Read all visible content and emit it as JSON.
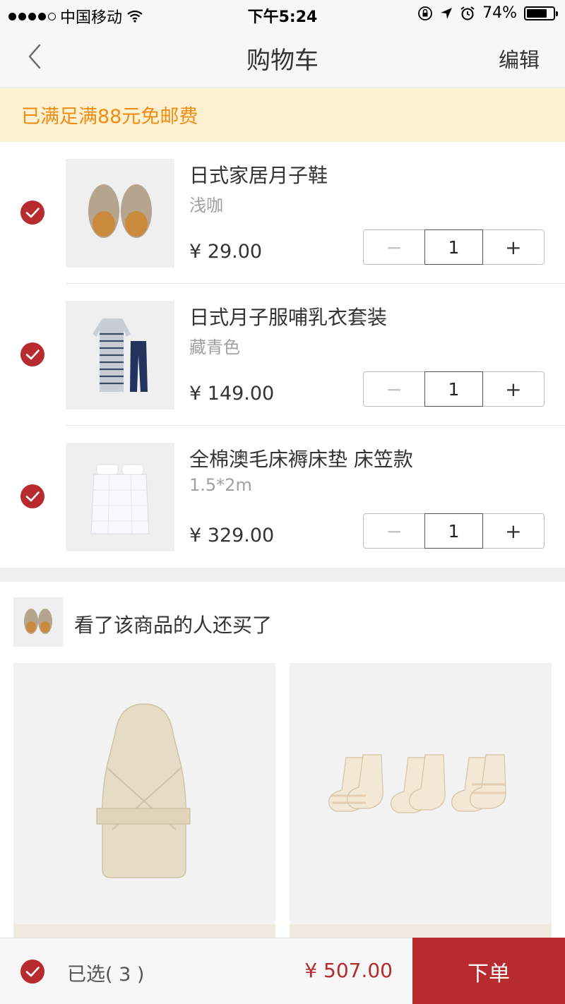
{
  "status_bar": {
    "carrier": "中国移动",
    "time": "下午5:24",
    "battery": "74%"
  },
  "nav": {
    "title": "购物车",
    "edit_label": "编辑"
  },
  "banner": {
    "text": "已满足满88元免邮费"
  },
  "cart": {
    "items": [
      {
        "name": "日式家居月子鞋",
        "spec": "浅咖",
        "price": "¥ 29.00",
        "quantity": "1",
        "icon": "slippers-image"
      },
      {
        "name": "日式月子服哺乳衣套装",
        "spec": "藏青色",
        "price": "¥ 149.00",
        "quantity": "1",
        "icon": "pajama-set-image"
      },
      {
        "name": "全棉澳毛床褥床垫 床笠款",
        "spec": "1.5*2m",
        "price": "¥ 329.00",
        "quantity": "1",
        "icon": "mattress-pad-image"
      }
    ],
    "minus_symbol": "−",
    "plus_symbol": "+"
  },
  "recommend": {
    "title": "看了该商品的人还买了",
    "cards": [
      {
        "icon": "baby-swaddle-image"
      },
      {
        "icon": "baby-socks-image"
      }
    ]
  },
  "bottom": {
    "selected_label": "已选( 3 )",
    "total": "¥ 507.00",
    "order_label": "下单"
  },
  "colors": {
    "accent": "#b72a2e",
    "banner_bg": "#fdf1d2",
    "banner_text": "#f08c12"
  }
}
